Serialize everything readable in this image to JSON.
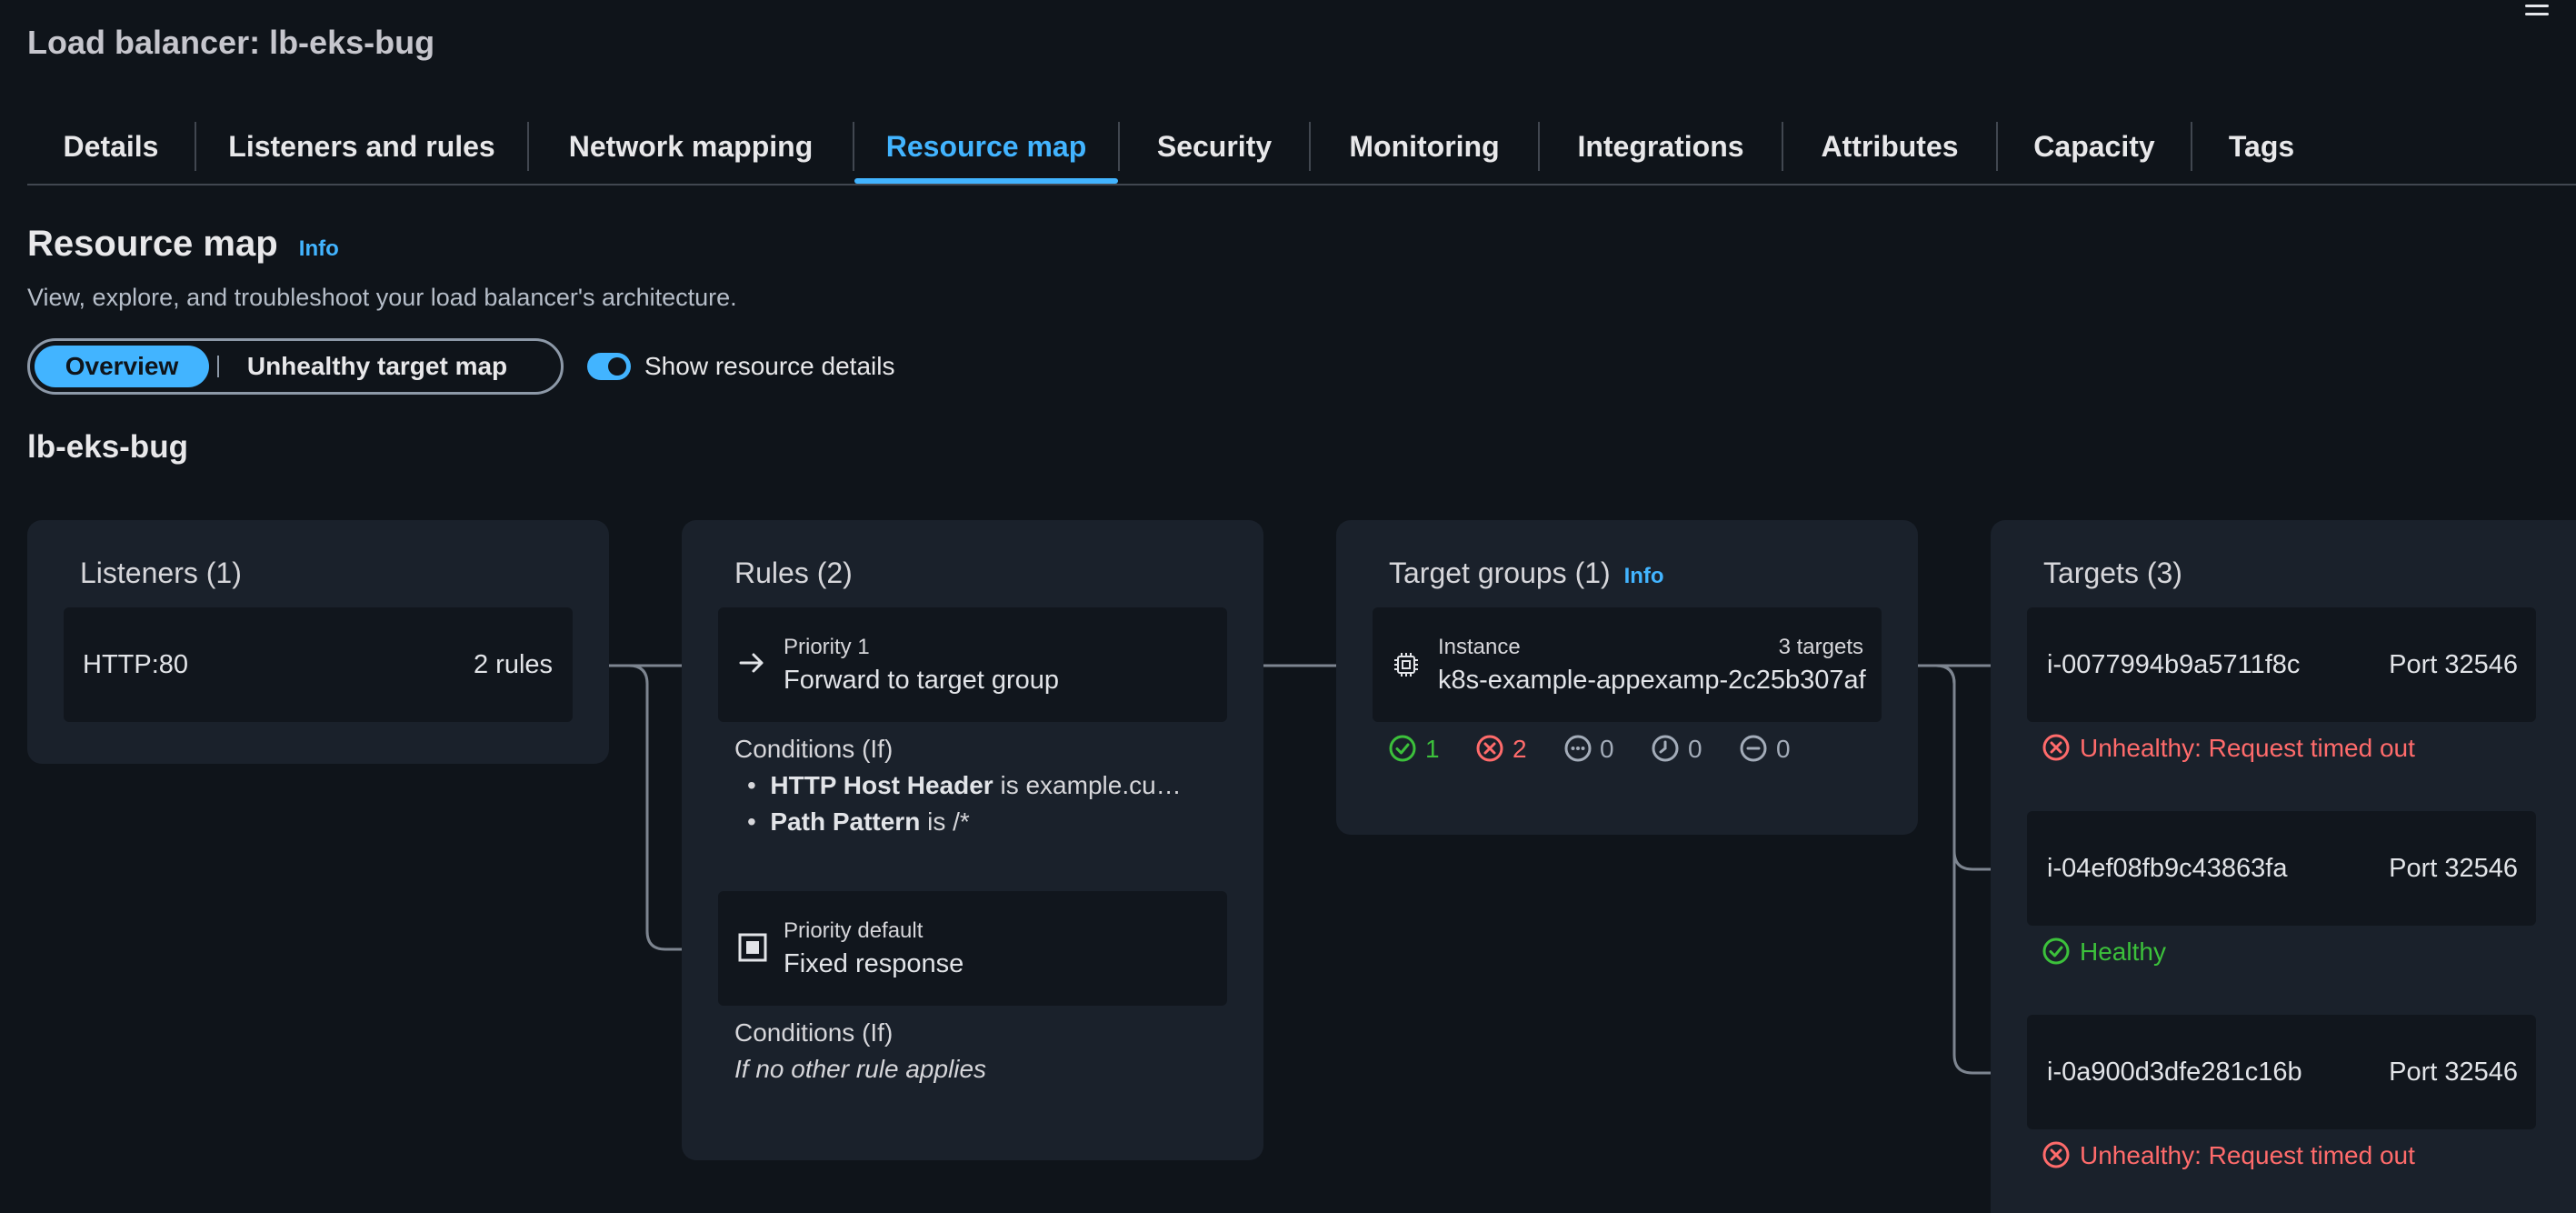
{
  "page": {
    "title": "Load balancer: lb-eks-bug"
  },
  "tabs": [
    {
      "label": "Details"
    },
    {
      "label": "Listeners and rules"
    },
    {
      "label": "Network mapping"
    },
    {
      "label": "Resource map",
      "active": true
    },
    {
      "label": "Security"
    },
    {
      "label": "Monitoring"
    },
    {
      "label": "Integrations"
    },
    {
      "label": "Attributes"
    },
    {
      "label": "Capacity"
    },
    {
      "label": "Tags"
    }
  ],
  "resource_map": {
    "title": "Resource map",
    "info": "Info",
    "description": "View, explore, and troubleshoot your load balancer's architecture.",
    "view_toggle": {
      "options": [
        "Overview",
        "Unhealthy target map"
      ],
      "selected": "Overview"
    },
    "show_details": {
      "label": "Show resource details",
      "enabled": true
    },
    "lb_name": "lb-eks-bug"
  },
  "listeners": {
    "title": "Listeners (1)",
    "items": [
      {
        "name": "HTTP:80",
        "rules": "2 rules"
      }
    ]
  },
  "rules": {
    "title": "Rules (2)",
    "items": [
      {
        "priority": "Priority 1",
        "action": "Forward to target group",
        "conditions_label": "Conditions (If)",
        "conditions": [
          {
            "key": "HTTP Host Header",
            "text": " is example.cu…"
          },
          {
            "key": "Path Pattern",
            "text": " is /*"
          }
        ]
      },
      {
        "priority": "Priority default",
        "action": "Fixed response",
        "conditions_label": "Conditions (If)",
        "conditions_text": "If no other rule applies"
      }
    ]
  },
  "target_groups": {
    "title": "Target groups (1)",
    "info": "Info",
    "items": [
      {
        "type": "Instance",
        "targets": "3 targets",
        "name": "k8s-example-appexamp-2c25b307af",
        "counts": {
          "healthy": "1",
          "unhealthy": "2",
          "unused": "0",
          "initial": "0",
          "draining": "0"
        }
      }
    ]
  },
  "targets": {
    "title": "Targets (3)",
    "items": [
      {
        "id": "i-0077994b9a5711f8c",
        "port": "Port 32546",
        "status": "Unhealthy: Request timed out",
        "state": "unhealthy"
      },
      {
        "id": "i-04ef08fb9c43863fa",
        "port": "Port 32546",
        "status": "Healthy",
        "state": "healthy"
      },
      {
        "id": "i-0a900d3dfe281c16b",
        "port": "Port 32546",
        "status": "Unhealthy: Request timed out",
        "state": "unhealthy"
      }
    ]
  },
  "colors": {
    "accent": "#42b4ff",
    "healthy": "#3cc13b",
    "unhealthy": "#ff6b6b",
    "background": "#0f141a",
    "panel": "#1a212b"
  }
}
